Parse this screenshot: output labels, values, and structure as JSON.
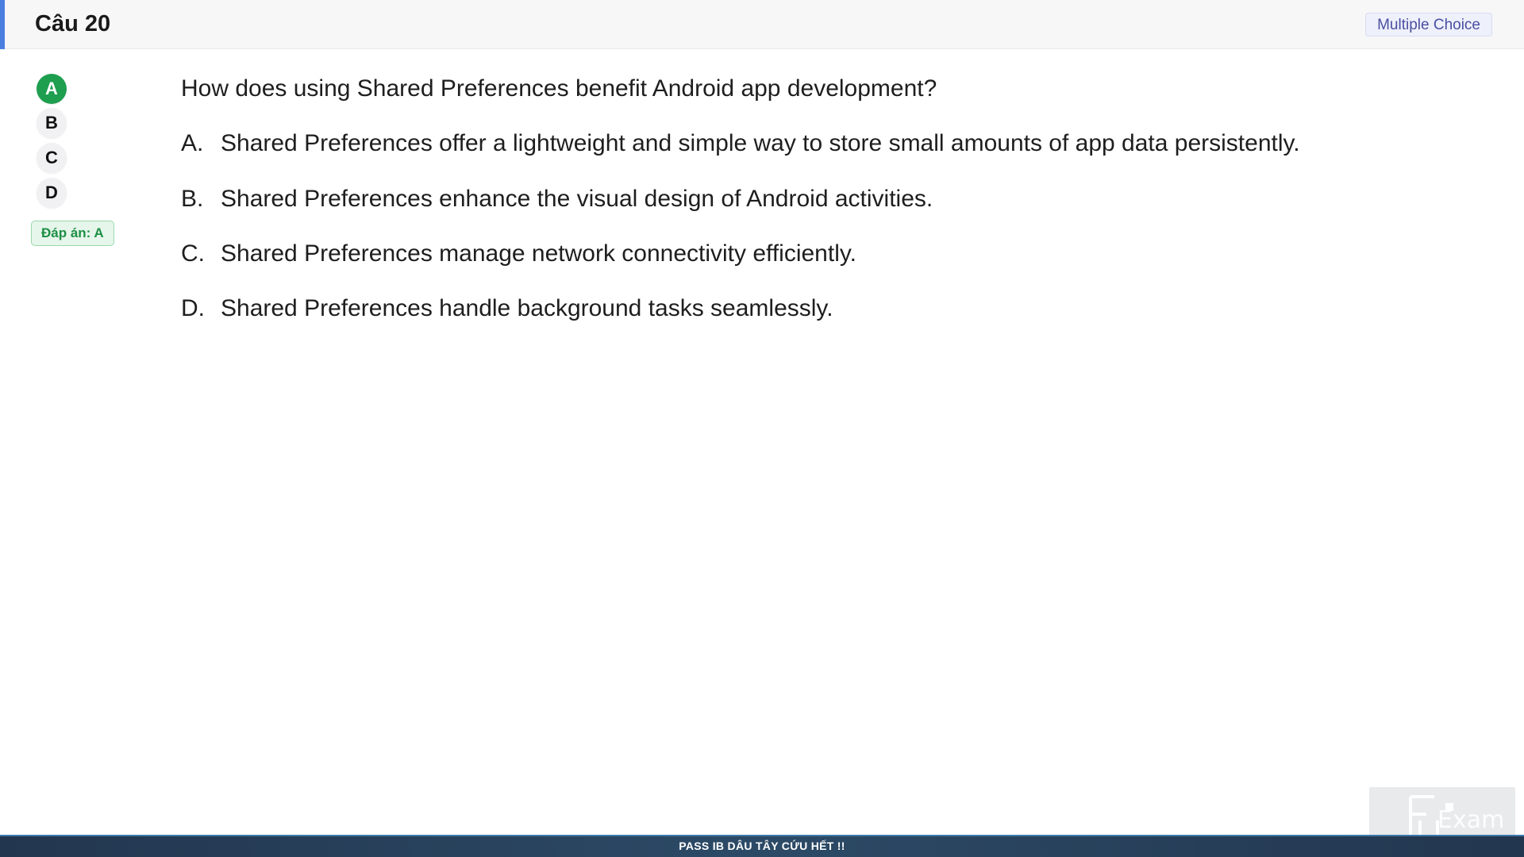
{
  "header": {
    "title": "Câu 20",
    "type_badge": "Multiple Choice"
  },
  "answer_selector": {
    "options": [
      "A",
      "B",
      "C",
      "D"
    ],
    "selected": "A",
    "answer_badge": "Đáp án: A"
  },
  "question": {
    "text": "How does using Shared Preferences benefit Android app development?",
    "choices": [
      {
        "letter": "A.",
        "text": "Shared Preferences offer a lightweight and simple way to store small amounts of app data persistently."
      },
      {
        "letter": "B.",
        "text": "Shared Preferences enhance the visual design of Android activities."
      },
      {
        "letter": "C.",
        "text": "Shared Preferences manage network connectivity efficiently."
      },
      {
        "letter": "D.",
        "text": "Shared Preferences handle background tasks seamlessly."
      }
    ]
  },
  "footer": {
    "text": "PASS IB DÂU TÂY CỨU HẾT !!"
  },
  "watermark": {
    "text": "Exam"
  },
  "colors": {
    "accent": "#4a7fe0",
    "selected": "#1e9e4f",
    "footer_bg": "#2c4a66"
  }
}
